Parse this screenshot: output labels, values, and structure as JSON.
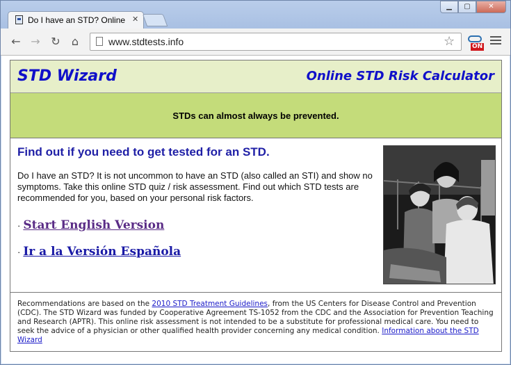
{
  "browser": {
    "tab_title": "Do I have an STD? Online",
    "url": "www.stdtests.info",
    "extension_badge": "ON"
  },
  "header": {
    "title": "STD Wizard",
    "subtitle": "Online STD Risk Calculator"
  },
  "banner": {
    "text": "STDs can almost always be prevented."
  },
  "main": {
    "heading": "Find out if you need to get tested for an STD.",
    "intro": "Do I have an STD? It is not uncommon to have an STD (also called an STI) and show no symptoms. Take this online STD quiz / risk assessment. Find out which STD tests are recommended for you, based on your personal risk factors.",
    "bullet": "·",
    "link_english": "Start English Version",
    "link_spanish": "Ir a la Versión Española"
  },
  "footer": {
    "text_before": "Recommendations are based on the ",
    "guidelines_link": "2010 STD Treatment Guidelines",
    "text_after": ", from the US Centers for Disease Control and Prevention (CDC). The STD Wizard was funded by Cooperative Agreement TS-1052 from the CDC and the Association for Prevention Teaching and Research (APTR). This online risk assessment is not intended to be a substitute for professional medical care. You need to seek the advice of a physician or other qualified health provider concerning any medical condition. ",
    "info_link": "Information about the STD Wizard"
  }
}
